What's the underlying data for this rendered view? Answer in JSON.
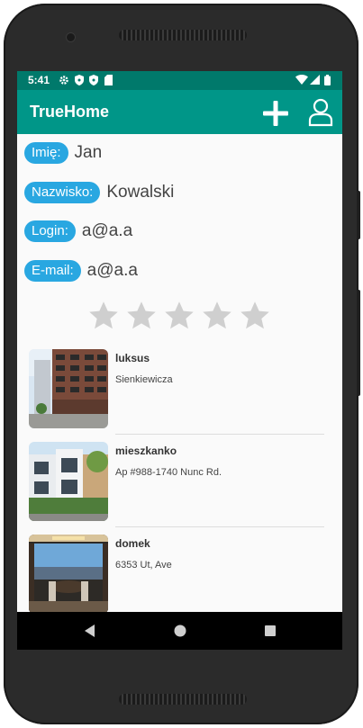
{
  "status_bar": {
    "time": "5:41",
    "icons": [
      "settings-icon",
      "shield-icon",
      "shield-icon",
      "sd-card-icon",
      "wifi-icon",
      "signal-icon",
      "battery-icon"
    ]
  },
  "app_bar": {
    "title": "TrueHome",
    "actions": [
      "add-icon",
      "user-profile-icon"
    ],
    "color": "#009688",
    "status_color": "#00796b"
  },
  "profile": {
    "fields": [
      {
        "label": "Imię:",
        "value": "Jan"
      },
      {
        "label": "Nazwisko:",
        "value": "Kowalski"
      },
      {
        "label": "Login:",
        "value": "a@a.a"
      },
      {
        "label": "E-mail:",
        "value": "a@a.a"
      }
    ],
    "chip_color": "#29a7e1"
  },
  "rating": {
    "value": 0,
    "max": 5,
    "star_color": "#cfcfcf"
  },
  "listings": [
    {
      "name": "luksus",
      "address": "Sienkiewicza",
      "image": "apartment-building-photo"
    },
    {
      "name": "mieszkanko",
      "address": "Ap #988-1740 Nunc Rd.",
      "image": "modern-houses-photo"
    },
    {
      "name": "domek",
      "address": "6353 Ut, Ave",
      "image": "dining-room-view-photo"
    }
  ],
  "nav_bar": {
    "buttons": [
      "back-icon",
      "home-icon",
      "recents-icon"
    ]
  }
}
